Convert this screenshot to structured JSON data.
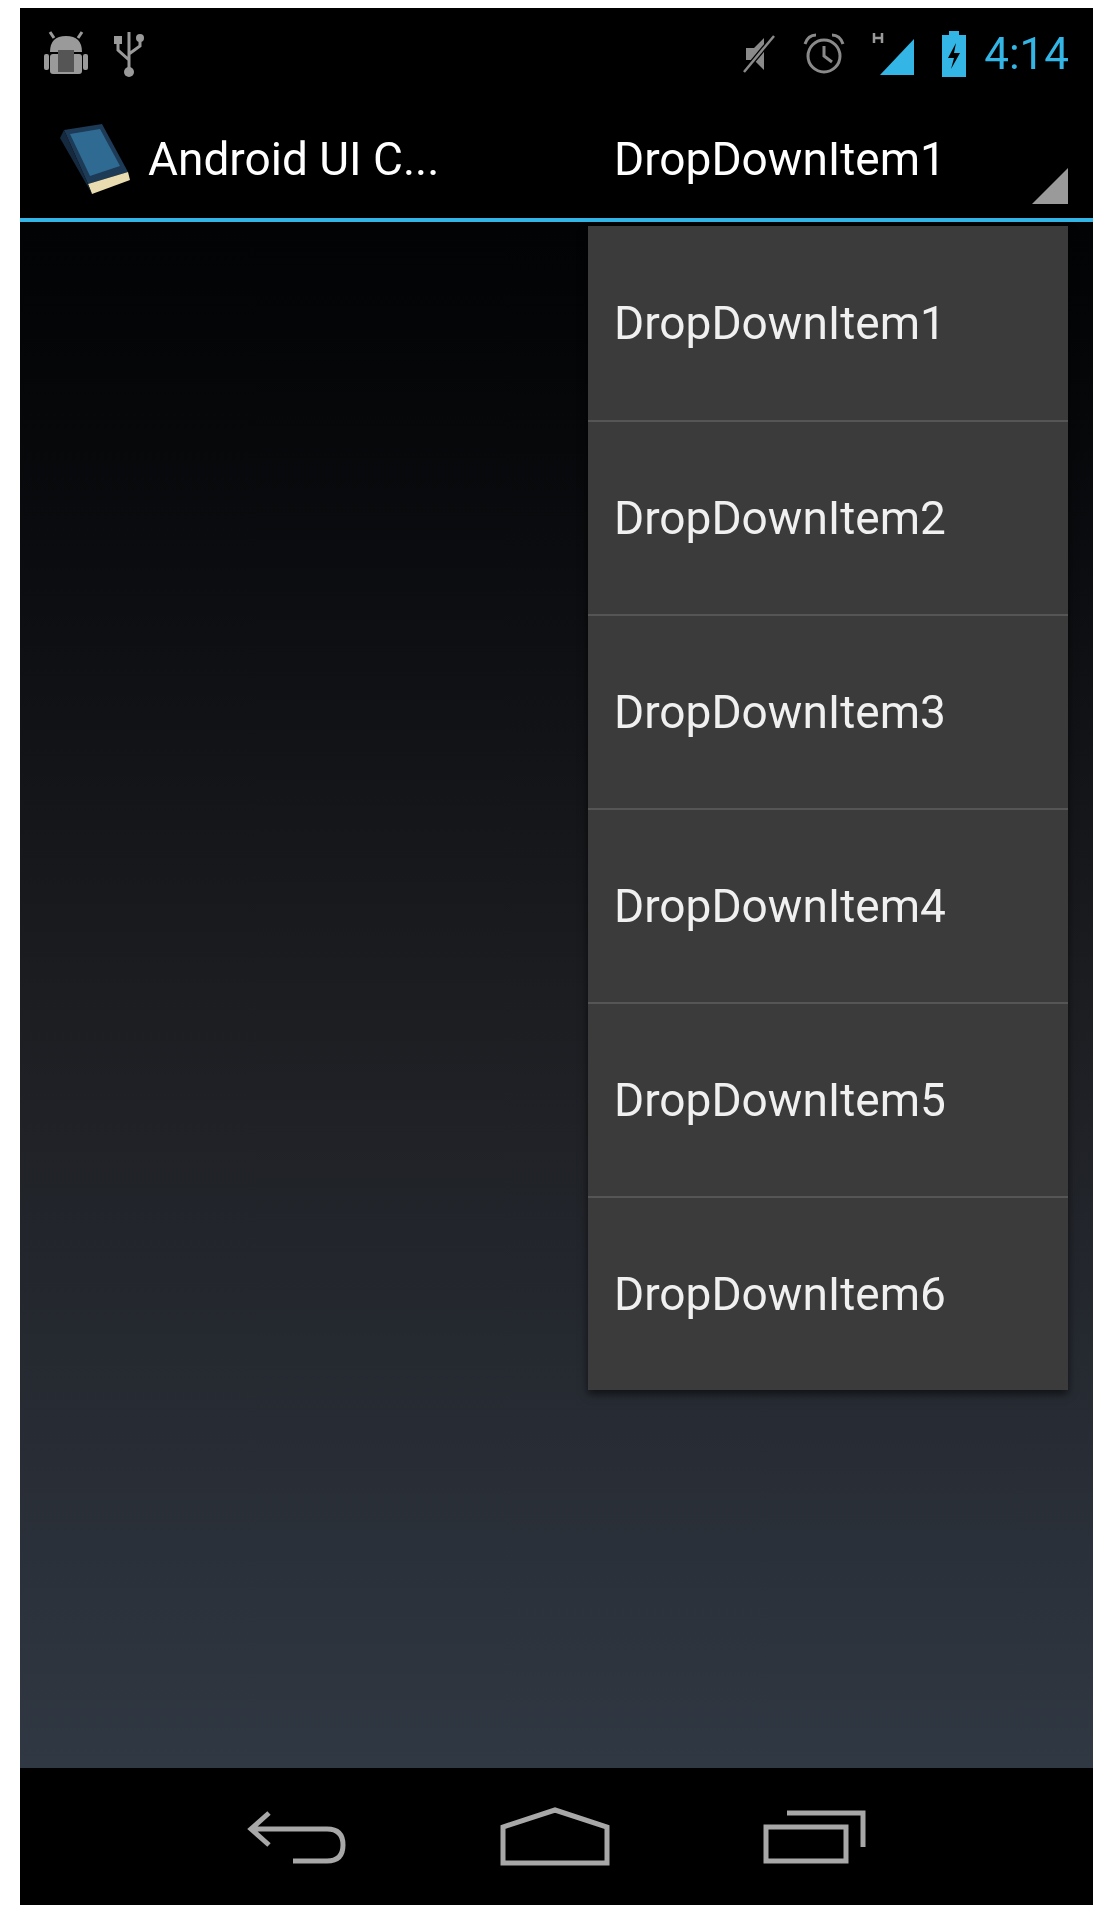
{
  "status_bar": {
    "time": "4:14"
  },
  "action_bar": {
    "title": "Android UI C...",
    "spinner": {
      "value": "DropDownItem1"
    }
  },
  "dropdown": {
    "items": [
      {
        "label": "DropDownItem1"
      },
      {
        "label": "DropDownItem2"
      },
      {
        "label": "DropDownItem3"
      },
      {
        "label": "DropDownItem4"
      },
      {
        "label": "DropDownItem5"
      },
      {
        "label": "DropDownItem6"
      }
    ]
  }
}
